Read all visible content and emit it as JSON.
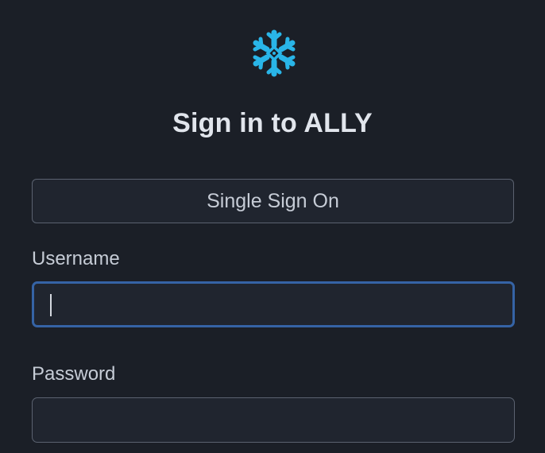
{
  "app": {
    "title": "Sign in to ALLY",
    "logo_icon": "snowflake-icon",
    "logo_color": "#29b5e8"
  },
  "sso": {
    "label": "Single Sign On"
  },
  "username": {
    "label": "Username",
    "value": "",
    "placeholder": ""
  },
  "password": {
    "label": "Password",
    "value": "",
    "placeholder": ""
  },
  "colors": {
    "background": "#1b1f27",
    "field_background": "#20252f",
    "focus_border": "#3563a5",
    "border": "#5b6270",
    "title_text": "#e1e5ec",
    "label_text": "#c6ccd6"
  }
}
